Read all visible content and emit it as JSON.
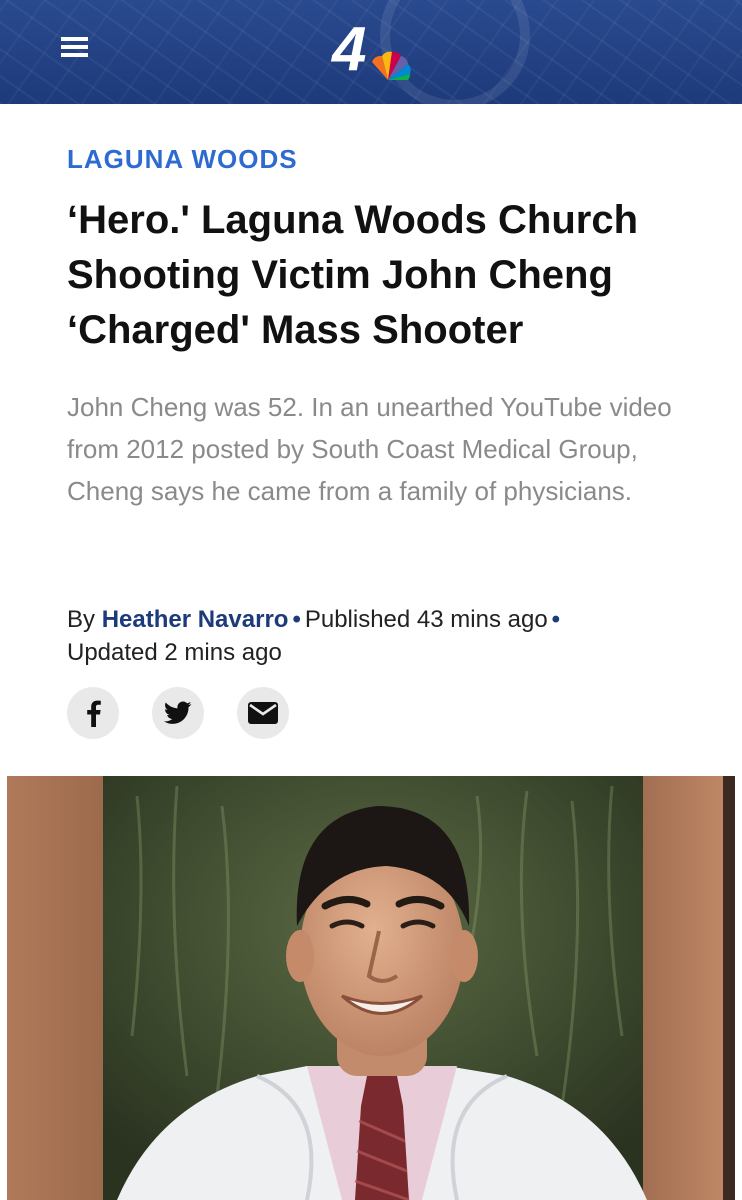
{
  "header": {
    "menu_icon": "hamburger-menu-icon",
    "logo_text": "4",
    "colors": {
      "background": "#1d3a7a",
      "accent": "#2e6bd1"
    }
  },
  "article": {
    "section": "LAGUNA WOODS",
    "headline": "‘Hero.' Laguna Woods Church Shooting Victim John Cheng ‘Charged' Mass Shooter",
    "summary": "John Cheng was 52. In an unearthed YouTube video from 2012 posted by South Coast Medical Group, Cheng says he came from a family of physicians.",
    "byline": {
      "by": "By",
      "author": "Heather Navarro",
      "published": "Published 43 mins ago",
      "updated": "Updated 2 mins ago"
    },
    "share": [
      {
        "icon": "facebook-icon"
      },
      {
        "icon": "twitter-icon"
      },
      {
        "icon": "email-icon"
      }
    ],
    "image": {
      "subject": "portrait-photo"
    }
  }
}
